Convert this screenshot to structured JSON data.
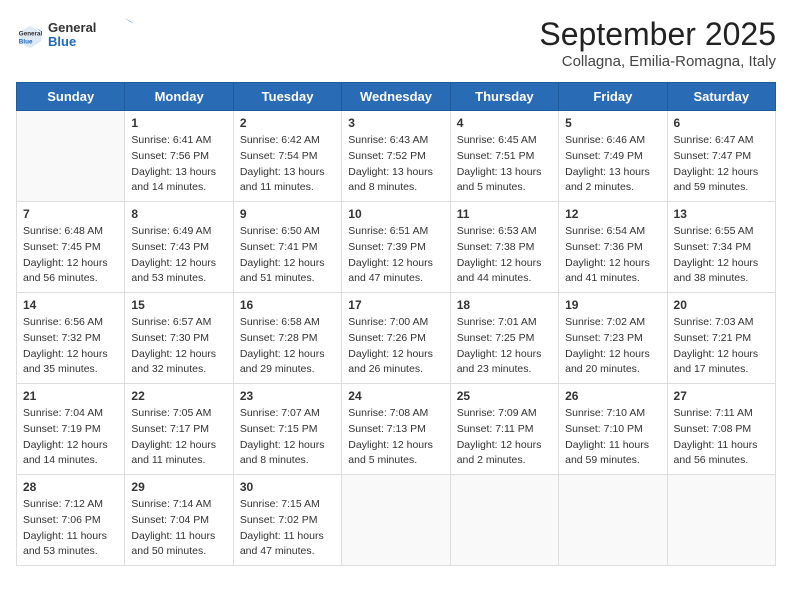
{
  "header": {
    "logo": {
      "general": "General",
      "blue": "Blue"
    },
    "title": "September 2025",
    "subtitle": "Collagna, Emilia-Romagna, Italy"
  },
  "calendar": {
    "weekdays": [
      "Sunday",
      "Monday",
      "Tuesday",
      "Wednesday",
      "Thursday",
      "Friday",
      "Saturday"
    ],
    "weeks": [
      [
        {
          "day": null,
          "info": null
        },
        {
          "day": "1",
          "sunrise": "6:41 AM",
          "sunset": "7:56 PM",
          "daylight": "13 hours and 14 minutes."
        },
        {
          "day": "2",
          "sunrise": "6:42 AM",
          "sunset": "7:54 PM",
          "daylight": "13 hours and 11 minutes."
        },
        {
          "day": "3",
          "sunrise": "6:43 AM",
          "sunset": "7:52 PM",
          "daylight": "13 hours and 8 minutes."
        },
        {
          "day": "4",
          "sunrise": "6:45 AM",
          "sunset": "7:51 PM",
          "daylight": "13 hours and 5 minutes."
        },
        {
          "day": "5",
          "sunrise": "6:46 AM",
          "sunset": "7:49 PM",
          "daylight": "13 hours and 2 minutes."
        },
        {
          "day": "6",
          "sunrise": "6:47 AM",
          "sunset": "7:47 PM",
          "daylight": "12 hours and 59 minutes."
        }
      ],
      [
        {
          "day": "7",
          "sunrise": "6:48 AM",
          "sunset": "7:45 PM",
          "daylight": "12 hours and 56 minutes."
        },
        {
          "day": "8",
          "sunrise": "6:49 AM",
          "sunset": "7:43 PM",
          "daylight": "12 hours and 53 minutes."
        },
        {
          "day": "9",
          "sunrise": "6:50 AM",
          "sunset": "7:41 PM",
          "daylight": "12 hours and 51 minutes."
        },
        {
          "day": "10",
          "sunrise": "6:51 AM",
          "sunset": "7:39 PM",
          "daylight": "12 hours and 47 minutes."
        },
        {
          "day": "11",
          "sunrise": "6:53 AM",
          "sunset": "7:38 PM",
          "daylight": "12 hours and 44 minutes."
        },
        {
          "day": "12",
          "sunrise": "6:54 AM",
          "sunset": "7:36 PM",
          "daylight": "12 hours and 41 minutes."
        },
        {
          "day": "13",
          "sunrise": "6:55 AM",
          "sunset": "7:34 PM",
          "daylight": "12 hours and 38 minutes."
        }
      ],
      [
        {
          "day": "14",
          "sunrise": "6:56 AM",
          "sunset": "7:32 PM",
          "daylight": "12 hours and 35 minutes."
        },
        {
          "day": "15",
          "sunrise": "6:57 AM",
          "sunset": "7:30 PM",
          "daylight": "12 hours and 32 minutes."
        },
        {
          "day": "16",
          "sunrise": "6:58 AM",
          "sunset": "7:28 PM",
          "daylight": "12 hours and 29 minutes."
        },
        {
          "day": "17",
          "sunrise": "7:00 AM",
          "sunset": "7:26 PM",
          "daylight": "12 hours and 26 minutes."
        },
        {
          "day": "18",
          "sunrise": "7:01 AM",
          "sunset": "7:25 PM",
          "daylight": "12 hours and 23 minutes."
        },
        {
          "day": "19",
          "sunrise": "7:02 AM",
          "sunset": "7:23 PM",
          "daylight": "12 hours and 20 minutes."
        },
        {
          "day": "20",
          "sunrise": "7:03 AM",
          "sunset": "7:21 PM",
          "daylight": "12 hours and 17 minutes."
        }
      ],
      [
        {
          "day": "21",
          "sunrise": "7:04 AM",
          "sunset": "7:19 PM",
          "daylight": "12 hours and 14 minutes."
        },
        {
          "day": "22",
          "sunrise": "7:05 AM",
          "sunset": "7:17 PM",
          "daylight": "12 hours and 11 minutes."
        },
        {
          "day": "23",
          "sunrise": "7:07 AM",
          "sunset": "7:15 PM",
          "daylight": "12 hours and 8 minutes."
        },
        {
          "day": "24",
          "sunrise": "7:08 AM",
          "sunset": "7:13 PM",
          "daylight": "12 hours and 5 minutes."
        },
        {
          "day": "25",
          "sunrise": "7:09 AM",
          "sunset": "7:11 PM",
          "daylight": "12 hours and 2 minutes."
        },
        {
          "day": "26",
          "sunrise": "7:10 AM",
          "sunset": "7:10 PM",
          "daylight": "11 hours and 59 minutes."
        },
        {
          "day": "27",
          "sunrise": "7:11 AM",
          "sunset": "7:08 PM",
          "daylight": "11 hours and 56 minutes."
        }
      ],
      [
        {
          "day": "28",
          "sunrise": "7:12 AM",
          "sunset": "7:06 PM",
          "daylight": "11 hours and 53 minutes."
        },
        {
          "day": "29",
          "sunrise": "7:14 AM",
          "sunset": "7:04 PM",
          "daylight": "11 hours and 50 minutes."
        },
        {
          "day": "30",
          "sunrise": "7:15 AM",
          "sunset": "7:02 PM",
          "daylight": "11 hours and 47 minutes."
        },
        {
          "day": null,
          "info": null
        },
        {
          "day": null,
          "info": null
        },
        {
          "day": null,
          "info": null
        },
        {
          "day": null,
          "info": null
        }
      ]
    ]
  }
}
